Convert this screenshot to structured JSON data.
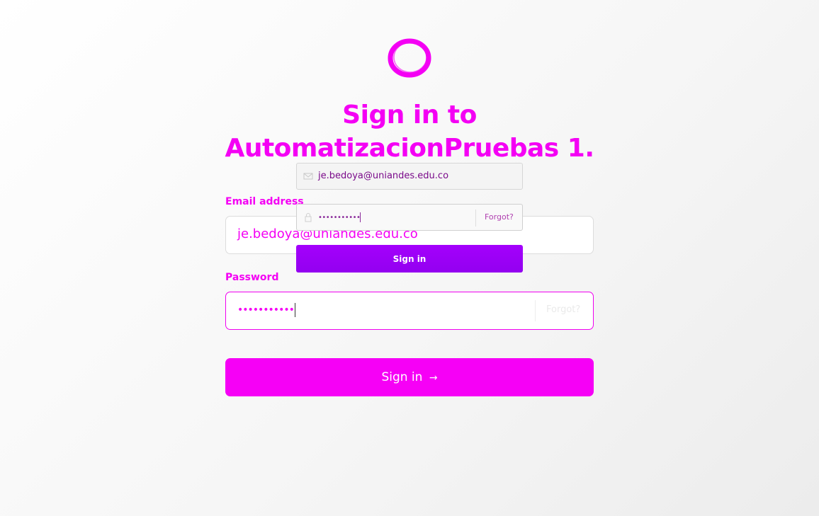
{
  "brand": {
    "logo_icon": "ring-logo-icon",
    "accent_color": "#f400f4",
    "overlay_button_color": "#9c00f6"
  },
  "header": {
    "title_line1": "Sign in to",
    "title_line2": "AutomatizacionPruebas 1."
  },
  "form": {
    "email_label": "Email address",
    "email_value": "je.bedoya@uniandes.edu.co",
    "password_label": "Password",
    "password_value": "•••••••••••",
    "forgot_label": "Forgot?",
    "submit_label": "Sign in",
    "submit_arrow": "→"
  },
  "overlay_form": {
    "email_icon": "envelope-icon",
    "email_value": "je.bedoya@uniandes.edu.co",
    "password_icon": "lock-icon",
    "password_value": "•••••••••••",
    "forgot_label": "Forgot?",
    "submit_label": "Sign in"
  }
}
